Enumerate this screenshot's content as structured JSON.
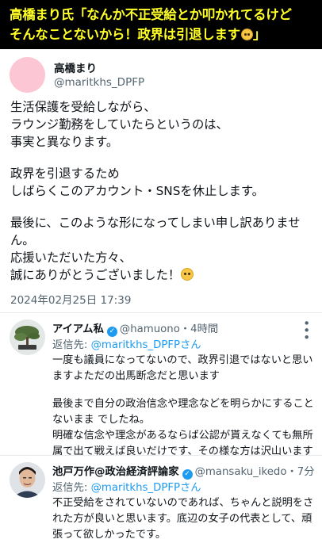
{
  "headline": {
    "line1": "高橋まり氏「なんか不正受給とか叩かれてるけど",
    "line2": "そんなことないから！政界は引退します",
    "line2_end": "」"
  },
  "main_tweet": {
    "author_name": "高橋まり",
    "author_handle": "@maritkhs_DPFP",
    "lines": [
      "生活保護を受給しながら、",
      "ラウンジ勤務をしていたらというのは、",
      "事実と異なります。",
      "政界を引退するため",
      "しばらくこのアカウント・SNSを休止します。",
      "最後に、このような形になってしまい申し訳ありません。",
      "応援いただいた方々、",
      "誠にありがとうございました！"
    ],
    "timestamp": "2024年02月25日 17:39"
  },
  "replies": [
    {
      "name": "アイアム私",
      "handle": "@hamuono",
      "time": "・4時間",
      "reply_to_prefix": "返信先: ",
      "reply_to_mention": "@maritkhs_DPFPさん",
      "paragraphs": [
        "一度も議員になってないので、政界引退ではないと思いますよただの出馬断念だと思います",
        "最後まで自分の政治信念や理念などを明らかにすることないまま でしたね。",
        "明確な信念や理念があるならば公認が貰えなくても無所属で出て戦えば良いだけです、その様な方は沢山います"
      ]
    },
    {
      "name": "池戸万作@政治経済評論家",
      "handle": "@mansaku_ikedo",
      "time": "・7分",
      "reply_to_prefix": "返信先: ",
      "reply_to_mention": "@maritkhs_DPFPさん",
      "paragraphs": [
        "不正受給をされていないのであれば、ちゃんと説明をされた方が良いと思います。底辺の女子の代表として、頑張って欲しかったです。"
      ]
    }
  ],
  "colors": {
    "headline_bg": "#000000",
    "headline_text": "#ffff26",
    "link": "#1d9bf0",
    "muted": "#536471",
    "avatar_pink": "#fcc6d4"
  },
  "icons": [
    "emoji-pleading-face-icon",
    "verified-badge-icon",
    "more-options-icon",
    "bonsai-avatar",
    "man-avatar"
  ]
}
